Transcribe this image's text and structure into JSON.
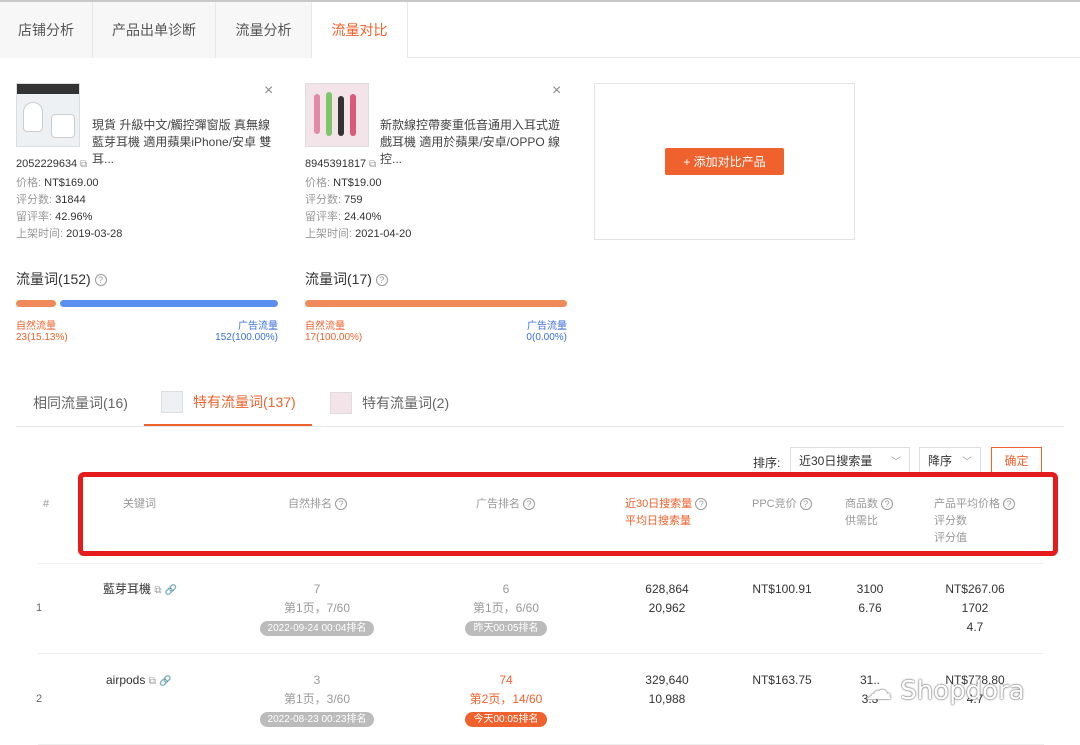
{
  "tabs": [
    "店铺分析",
    "产品出单诊断",
    "流量分析",
    "流量对比"
  ],
  "active_tab": 3,
  "products": [
    {
      "name": "現貨 升級中文/觸控彈窗版 真無線藍芽耳機 適用蘋果iPhone/安卓 雙耳...",
      "id": "2052229634",
      "price_label": "价格:",
      "price": "NT$169.00",
      "reviews_label": "评分数:",
      "reviews": "31844",
      "rate_label": "留评率:",
      "rate": "42.96%",
      "date_label": "上架时间:",
      "date": "2019-03-28",
      "traffic_title": "流量词(152)",
      "natural_label": "自然流量",
      "natural_value": "23(15.13%)",
      "ad_label": "广告流量",
      "ad_value": "152(100.00%)",
      "natural_fraction": 0.1513
    },
    {
      "name": "新款線控帶麥重低音通用入耳式遊戲耳機 適用於蘋果/安卓/OPPO 線控...",
      "id": "8945391817",
      "price_label": "价格:",
      "price": "NT$19.00",
      "reviews_label": "评分数:",
      "reviews": "759",
      "rate_label": "留评率:",
      "rate": "24.40%",
      "date_label": "上架时间:",
      "date": "2021-04-20",
      "traffic_title": "流量词(17)",
      "natural_label": "自然流量",
      "natural_value": "17(100.00%)",
      "ad_label": "广告流量",
      "ad_value": "0(0.00%)",
      "natural_fraction": 1.0
    }
  ],
  "add_button": "+ 添加对比产品",
  "sub_tabs": [
    "相同流量词(16)",
    "特有流量词(137)",
    "特有流量词(2)"
  ],
  "sort": {
    "label": "排序:",
    "value": "近30日搜索量",
    "order": "降序",
    "confirm": "确定"
  },
  "headers": {
    "index": "#",
    "keyword": "关键词",
    "natural_rank": "自然排名",
    "ad_rank": "广告排名",
    "search_30": "近30日搜索量",
    "search_avg": "平均日搜索量",
    "ppc": "PPC竞价",
    "goods": "商品数",
    "supply": "供需比",
    "avg_price": "产品平均价格",
    "rating_count": "评分数",
    "rating_value": "评分值"
  },
  "rows": [
    {
      "index": "1",
      "keyword": "藍芽耳機",
      "nat_rank": "7",
      "nat_page": "第1页，7/60",
      "nat_time": "2022-09-24 00:04排名",
      "ad_rank": "6",
      "ad_page": "第1页，6/60",
      "ad_time": "昨天00:05排名",
      "search30": "628,864",
      "search_avg": "20,962",
      "ppc": "NT$100.91",
      "goods": "3100",
      "supply": "6.76",
      "avg_price": "NT$267.06",
      "rcount": "1702",
      "rvalue": "4.7"
    },
    {
      "index": "2",
      "keyword": "airpods",
      "nat_rank": "3",
      "nat_page": "第1页，3/60",
      "nat_time": "2022-08-23 00:23排名",
      "ad_rank": "74",
      "ad_page": "第2页，14/60",
      "ad_time": "今天00:05排名",
      "search30": "329,640",
      "search_avg": "10,988",
      "ppc": "NT$163.75",
      "goods": "31..",
      "supply": "3.3",
      "avg_price": "NT$778.80",
      "rcount": "",
      "rvalue": "4.7"
    }
  ],
  "watermark": "Shopdora",
  "colors": {
    "accent": "#f0622d",
    "blue": "#3a6fd8",
    "highlight_box": "#e51c1c"
  }
}
